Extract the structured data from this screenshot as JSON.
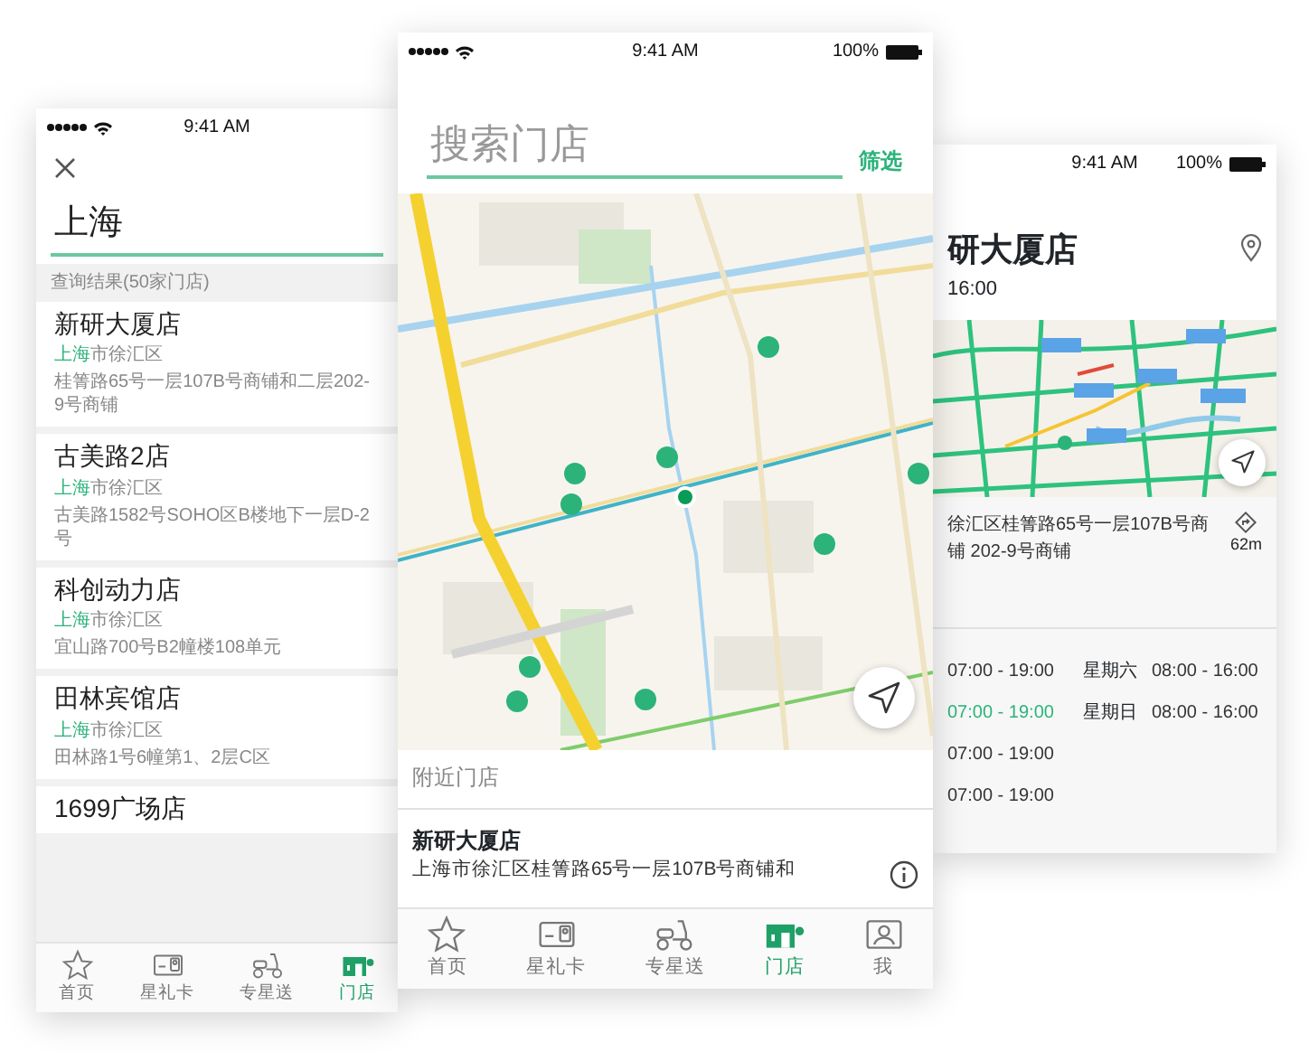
{
  "left_phone": {
    "status_bar": {
      "time": "9:41 AM"
    },
    "search": {
      "value": "上海"
    },
    "result_count": "查询结果(50家门店)",
    "stores": [
      {
        "name": "新研大厦店",
        "city_highlight": "上海",
        "city_rest": "市徐汇区",
        "address": "桂箐路65号一层107B号商铺和二层202-9号商铺"
      },
      {
        "name": "古美路2店",
        "city_highlight": "上海",
        "city_rest": "市徐汇区",
        "address": "古美路1582号SOHO区B楼地下一层D-2号"
      },
      {
        "name": "科创动力店",
        "city_highlight": "上海",
        "city_rest": "市徐汇区",
        "address": "宜山路700号B2幢楼108单元"
      },
      {
        "name": "田林宾馆店",
        "city_highlight": "上海",
        "city_rest": "市徐汇区",
        "address": "田林路1号6幢第1、2层C区"
      },
      {
        "name": "1699广场店"
      }
    ],
    "tab_bar": [
      {
        "label": "首页",
        "kind": "star",
        "selected": false
      },
      {
        "label": "星礼卡",
        "kind": "card",
        "selected": false
      },
      {
        "label": "专星送",
        "kind": "scooter",
        "selected": false
      },
      {
        "label": "门店",
        "kind": "store",
        "selected": true
      }
    ]
  },
  "center_phone": {
    "status_bar": {
      "time": "9:41 AM",
      "battery": "100%"
    },
    "search": {
      "placeholder": "搜索门店"
    },
    "filter_button": "筛选",
    "nearby_header": "附近门店",
    "store": {
      "name": "新研大厦店",
      "address": "上海市徐汇区桂箐路65号一层107B号商铺和"
    },
    "tab_bar": [
      {
        "label": "首页",
        "kind": "star",
        "selected": false
      },
      {
        "label": "星礼卡",
        "kind": "card",
        "selected": false
      },
      {
        "label": "专星送",
        "kind": "scooter",
        "selected": false
      },
      {
        "label": "门店",
        "kind": "store",
        "selected": true
      },
      {
        "label": "我",
        "kind": "person",
        "selected": false
      }
    ]
  },
  "right_phone": {
    "status_bar": {
      "time": "9:41 AM",
      "battery": "100%"
    },
    "store_title": "研大厦店",
    "hours_summary": "16:00",
    "address": "徐汇区桂箐路65号一层107B号商铺 202-9号商铺",
    "distance": "62m",
    "weekday_hours": [
      {
        "time": "07:00 - 19:00",
        "today": false
      },
      {
        "time": "07:00 - 19:00",
        "today": true
      },
      {
        "time": "07:00 - 19:00",
        "today": false
      },
      {
        "time": "07:00 - 19:00",
        "today": false
      }
    ],
    "weekend_hours": [
      {
        "day": "星期六",
        "time": "08:00 - 16:00"
      },
      {
        "day": "星期日",
        "time": "08:00 - 16:00"
      }
    ]
  }
}
